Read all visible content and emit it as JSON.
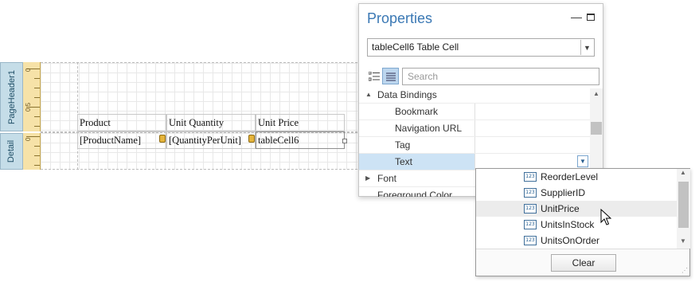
{
  "designer": {
    "bands": [
      {
        "label": "PageHeader1"
      },
      {
        "label": "Detail"
      }
    ],
    "ruler": {
      "marks": [
        "0",
        "0.5",
        "0"
      ]
    },
    "header_cells": [
      "Product",
      "Unit Quantity",
      "Unit Price"
    ],
    "detail_cells": [
      "[ProductName]",
      "[QuantityPerUnit]",
      "tableCell6"
    ]
  },
  "properties": {
    "title": "Properties",
    "minimize_icon": "minimize-icon",
    "maximize_icon": "maximize-icon",
    "selected_object": "tableCell6  Table Cell",
    "search_placeholder": "Search",
    "rows": [
      {
        "label": "Data Bindings",
        "expander": "▲",
        "indent": 0
      },
      {
        "label": "Bookmark",
        "indent": 1
      },
      {
        "label": "Navigation URL",
        "indent": 1
      },
      {
        "label": "Tag",
        "indent": 1
      },
      {
        "label": "Text",
        "indent": 1,
        "selected": true
      },
      {
        "label": "Font",
        "expander": "▶",
        "indent": 0
      },
      {
        "label": "Foreground Color",
        "indent": 0
      }
    ]
  },
  "field_dropdown": {
    "items": [
      {
        "label": "ReorderLevel",
        "icon_text": "123"
      },
      {
        "label": "SupplierID",
        "icon_text": "123"
      },
      {
        "label": "UnitPrice",
        "icon_text": "123",
        "hover": true
      },
      {
        "label": "UnitsInStock",
        "icon_text": "123"
      },
      {
        "label": "UnitsOnOrder",
        "icon_text": "123"
      }
    ],
    "clear_label": "Clear"
  },
  "colors": {
    "accent": "#3a78b4",
    "band_tab": "#c5dde8",
    "ruler": "#f6e2a8",
    "selection": "#cde3f5"
  }
}
